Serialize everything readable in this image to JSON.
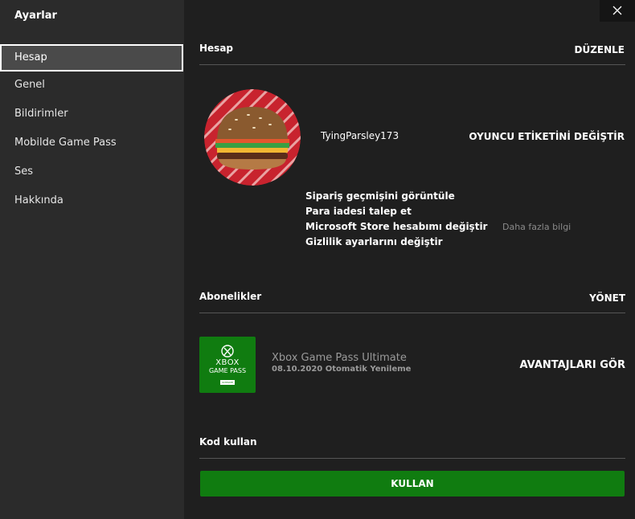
{
  "sidebar": {
    "title": "Ayarlar",
    "items": [
      {
        "label": "Hesap",
        "active": true
      },
      {
        "label": "Genel",
        "active": false
      },
      {
        "label": "Bildirimler",
        "active": false
      },
      {
        "label": "Mobilde Game Pass",
        "active": false
      },
      {
        "label": "Ses",
        "active": false
      },
      {
        "label": "Hakkında",
        "active": false
      }
    ]
  },
  "window": {
    "close_icon": "close-icon"
  },
  "account": {
    "title": "Hesap",
    "edit_label": "DÜZENLE",
    "gamertag": "TyingParsley173",
    "change_gamertag_label": "OYUNCU ETİKETİNİ DEĞİŞTİR",
    "links": [
      "Sipariş geçmişini görüntüle",
      "Para iadesi talep et",
      "Microsoft Store hesabımı değiştir",
      "Gizlilik ayarlarını değiştir"
    ],
    "more_info": "Daha fazla bilgi"
  },
  "subscriptions": {
    "title": "Abonelikler",
    "manage_label": "YÖNET",
    "tile_text_1": "XBOX",
    "tile_text_2": "GAME PASS",
    "tile_badge": "ULTIMATE",
    "name": "Xbox Game Pass Ultimate",
    "renewal": "08.10.2020 Otomatik Yenileme",
    "perks_label": "AVANTAJLARI GÖR"
  },
  "redeem": {
    "title": "Kod kullan",
    "button_label": "KULLAN"
  },
  "colors": {
    "accent_green": "#107c10",
    "background": "#1f1f1f",
    "sidebar": "#2b2b2b"
  }
}
